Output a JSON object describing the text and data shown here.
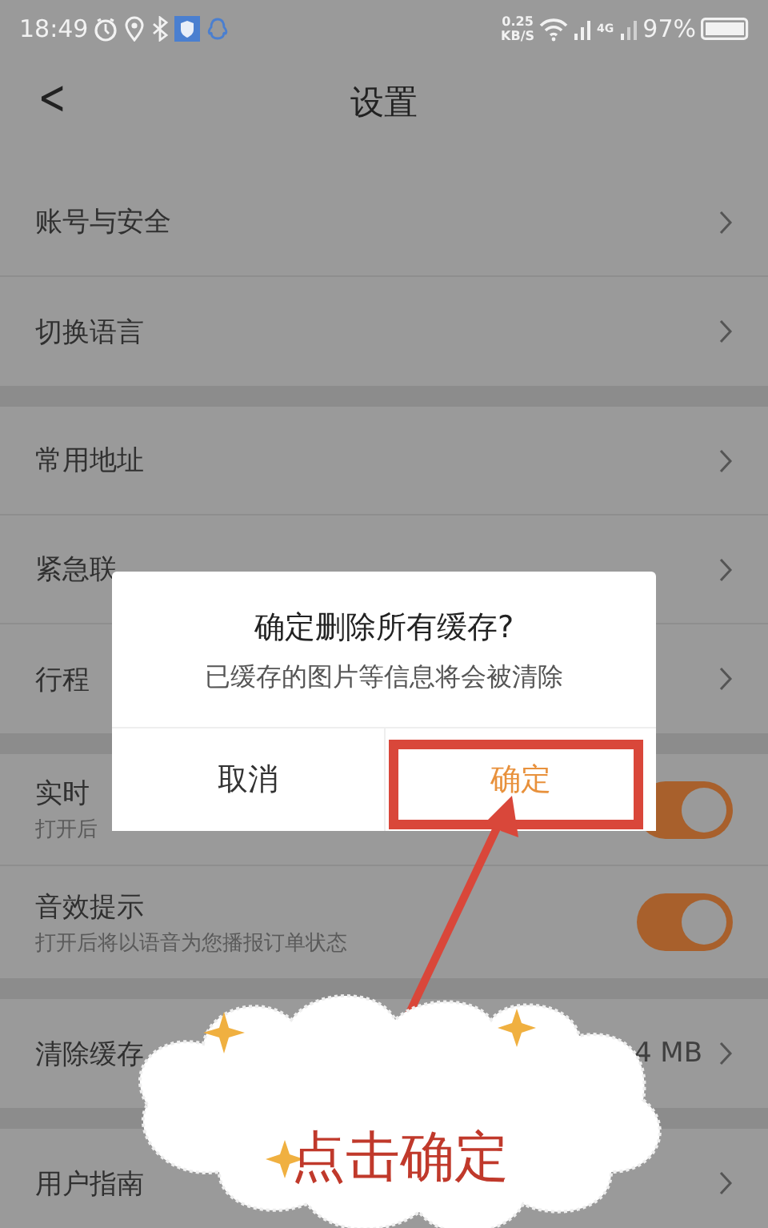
{
  "status_bar": {
    "time": "18:49",
    "speed_value": "0.25",
    "speed_unit": "KB/S",
    "network": "4G",
    "battery": "97%"
  },
  "header": {
    "back": "<",
    "title": "设置"
  },
  "groups": [
    {
      "rows": [
        {
          "kind": "link",
          "label": "账号与安全"
        },
        {
          "kind": "link",
          "label": "切换语言"
        }
      ]
    },
    {
      "rows": [
        {
          "kind": "link",
          "label": "常用地址"
        },
        {
          "kind": "link",
          "label": "紧急联"
        },
        {
          "kind": "link",
          "label": "行程"
        }
      ]
    },
    {
      "rows": [
        {
          "kind": "toggle",
          "label": "实时",
          "subtitle": "打开后",
          "on": true
        },
        {
          "kind": "toggle",
          "label": "音效提示",
          "subtitle": "打开后将以语音为您播报订单状态",
          "on": true
        }
      ]
    },
    {
      "rows": [
        {
          "kind": "link",
          "label": "清除缓存",
          "value": "4 MB"
        }
      ]
    },
    {
      "rows": [
        {
          "kind": "link",
          "label": "用户指南"
        }
      ]
    }
  ],
  "dialog": {
    "title": "确定删除所有缓存?",
    "message": "已缓存的图片等信息将会被清除",
    "buttons": [
      {
        "label": "取消",
        "kind": "cancel",
        "highlighted": false
      },
      {
        "label": "确定",
        "kind": "confirm",
        "highlighted": true
      }
    ]
  },
  "annotation": {
    "label": "点击确定"
  }
}
